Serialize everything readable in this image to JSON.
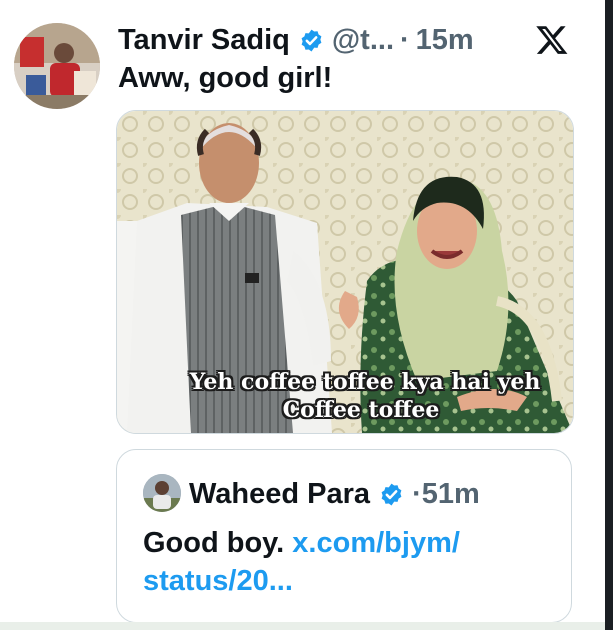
{
  "post": {
    "author_name": "Tanvir Sadiq",
    "handle": "@t...",
    "separator": "·",
    "time": "15m",
    "text": "Aww, good girl!",
    "media_caption_line1": "Yeh coffee toffee kya hai yeh",
    "media_caption_line2": "Coffee toffee"
  },
  "quoted_post": {
    "author_name": "Waheed Para",
    "separator": "·",
    "time": "51m",
    "text": "Good boy.",
    "link_line1": "x.com/bjym/",
    "link_line2": "status/20..."
  },
  "icons": {
    "verified": "verified-badge-icon",
    "platform": "x-logo-icon"
  },
  "colors": {
    "verified_blue": "#1d9bf0",
    "link_blue": "#1d9bf0",
    "muted_text": "#536471"
  }
}
